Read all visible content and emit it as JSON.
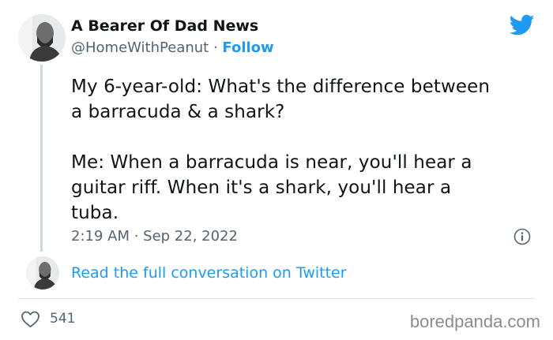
{
  "tweet": {
    "author_name": "A Bearer Of Dad News",
    "handle": "@HomeWithPeanut",
    "separator": " · ",
    "follow_label": "Follow",
    "text": "My 6-year-old: What's the difference between\na barracuda & a shark?\n\nMe: When a barracuda is near, you'll hear a\nguitar riff. When it's a shark, you'll hear a\ntuba.",
    "timestamp": "2:19 AM · Sep 22, 2022",
    "read_more_label": "Read the full conversation on Twitter",
    "like_count": "541"
  },
  "icons": {
    "brand": "twitter-bird-icon",
    "info": "info-icon",
    "like": "heart-icon"
  },
  "watermark": "boredpanda.com",
  "colors": {
    "accent": "#1d9bf0",
    "secondary_text": "#536471",
    "primary_text": "#0f1419"
  }
}
